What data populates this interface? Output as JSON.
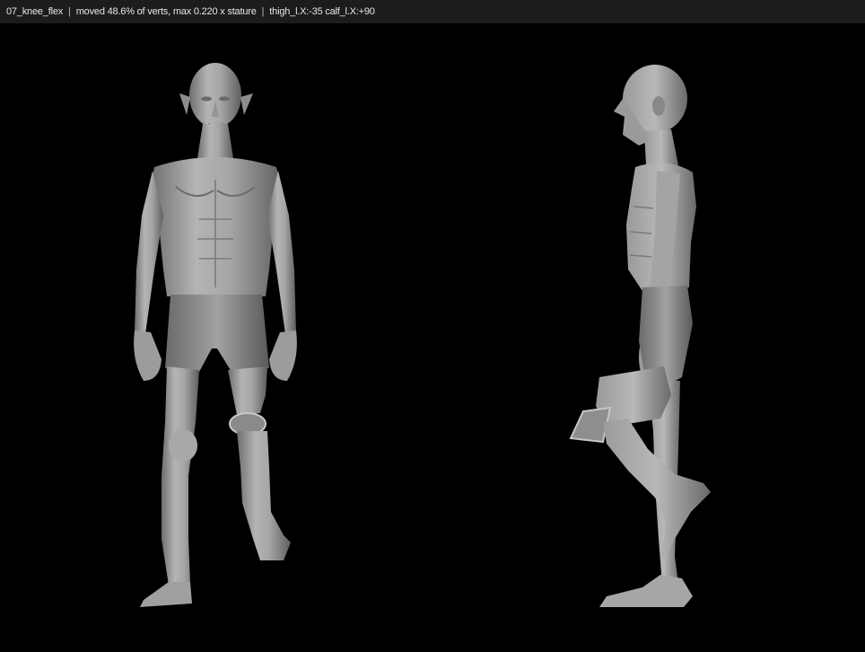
{
  "window": {
    "scene_name": "07_knee_flex",
    "separator": "|",
    "stats": "moved 48.6% of verts, max 0.220 x stature",
    "pose": "thigh_l.X:-35 calf_l.X:+90"
  },
  "viewport": {
    "background": "#000000",
    "mesh_color": "#a9a9a9",
    "views": [
      "front",
      "side"
    ]
  }
}
